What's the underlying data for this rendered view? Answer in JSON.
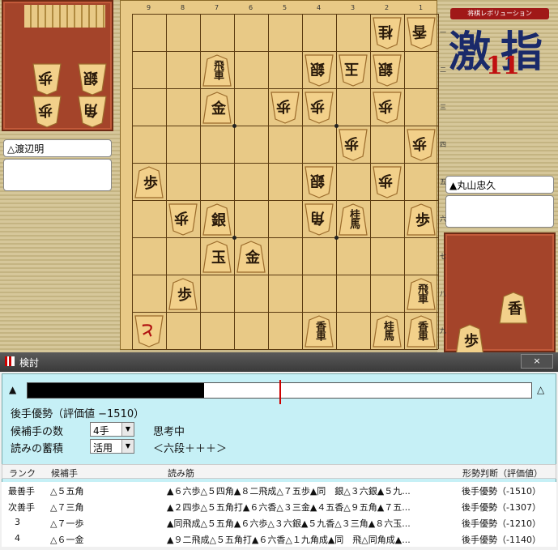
{
  "window_title": "検討",
  "close_label": "×",
  "logo": {
    "banner": "将棋レボリューション",
    "kanji_1": "激",
    "kanji_2": "指",
    "number": "11"
  },
  "players": {
    "gote": "△渡辺明",
    "sente": "▲丸山忠久"
  },
  "files": [
    "9",
    "8",
    "7",
    "6",
    "5",
    "4",
    "3",
    "2",
    "1"
  ],
  "ranks": [
    "一",
    "二",
    "三",
    "四",
    "五",
    "六",
    "七",
    "八",
    "九"
  ],
  "board": [
    {
      "f": 2,
      "r": 1,
      "t": "桂",
      "s": "gote"
    },
    {
      "f": 1,
      "r": 1,
      "t": "香",
      "s": "gote"
    },
    {
      "f": 7,
      "r": 2,
      "t": "飛",
      "s": "sente_gote_flip",
      "label": "飛車"
    },
    {
      "f": 4,
      "r": 2,
      "t": "銀",
      "s": "gote"
    },
    {
      "f": 3,
      "r": 2,
      "t": "玉",
      "s": "gote"
    },
    {
      "f": 2,
      "r": 2,
      "t": "銀",
      "s": "gote"
    },
    {
      "f": 7,
      "r": 3,
      "t": "金",
      "s": "sente"
    },
    {
      "f": 5,
      "r": 3,
      "t": "歩",
      "s": "gote"
    },
    {
      "f": 4,
      "r": 3,
      "t": "歩",
      "s": "gote"
    },
    {
      "f": 2,
      "r": 3,
      "t": "歩",
      "s": "gote"
    },
    {
      "f": 3,
      "r": 4,
      "t": "歩",
      "s": "gote"
    },
    {
      "f": 1,
      "r": 4,
      "t": "歩",
      "s": "gote"
    },
    {
      "f": 9,
      "r": 5,
      "t": "歩",
      "s": "sente"
    },
    {
      "f": 4,
      "r": 5,
      "t": "銀",
      "s": "gote"
    },
    {
      "f": 2,
      "r": 5,
      "t": "歩",
      "s": "gote"
    },
    {
      "f": 8,
      "r": 6,
      "t": "歩",
      "s": "gote"
    },
    {
      "f": 7,
      "r": 6,
      "t": "銀",
      "s": "sente"
    },
    {
      "f": 4,
      "r": 6,
      "t": "角",
      "s": "gote"
    },
    {
      "f": 3,
      "r": 6,
      "t": "桂",
      "s": "sente",
      "label": "桂馬"
    },
    {
      "f": 1,
      "r": 6,
      "t": "歩",
      "s": "sente"
    },
    {
      "f": 7,
      "r": 7,
      "t": "玉",
      "s": "sente"
    },
    {
      "f": 6,
      "r": 7,
      "t": "金",
      "s": "sente"
    },
    {
      "f": 8,
      "r": 8,
      "t": "歩",
      "s": "sente"
    },
    {
      "f": 1,
      "r": 8,
      "t": "飛",
      "s": "sente",
      "label": "飛車"
    },
    {
      "f": 9,
      "r": 9,
      "t": "と",
      "s": "gote",
      "prom": true
    },
    {
      "f": 4,
      "r": 9,
      "t": "香",
      "s": "sente",
      "label": "香車"
    },
    {
      "f": 2,
      "r": 9,
      "t": "桂",
      "s": "sente",
      "label": "桂馬"
    },
    {
      "f": 1,
      "r": 9,
      "t": "香",
      "s": "sente",
      "label": "香車"
    }
  ],
  "gote_hand": [
    "歩",
    "銀",
    "歩",
    "角"
  ],
  "sente_hand": [
    "香",
    "歩"
  ],
  "eval": {
    "status": "後手優勢（評価値 −1510）",
    "fill_fraction": 0.35,
    "mark_fraction": 0.5
  },
  "controls": {
    "candidates_label": "候補手の数",
    "candidates_value": "4手",
    "thinking": "思考中",
    "accumulate_label": "読みの蓄積",
    "accumulate_value": "活用",
    "level": "＜六段＋＋＋＞"
  },
  "table": {
    "headers": [
      "ランク",
      "候補手",
      "読み筋",
      "形勢判断（評価値）"
    ],
    "rows": [
      [
        "最善手",
        "△５五角",
        "▲６六歩△５四角▲８二飛成△７五歩▲同　銀△３六銀▲５九...",
        "後手優勢（-1510）"
      ],
      [
        "次善手",
        "△７三角",
        "▲２四歩△５五角打▲６六香△３三金▲４五香△９五角▲７五...",
        "後手優勢（-1307）"
      ],
      [
        "3",
        "△７一歩",
        "▲同飛成△５五角▲６六歩△３六銀▲５九香△３三角▲８六玉...",
        "後手優勢（-1210）"
      ],
      [
        "4",
        "△６一金",
        "▲９二飛成△５五角打▲６六香△１九角成▲同　飛△同角成▲...",
        "後手優勢（-1140）"
      ]
    ]
  }
}
